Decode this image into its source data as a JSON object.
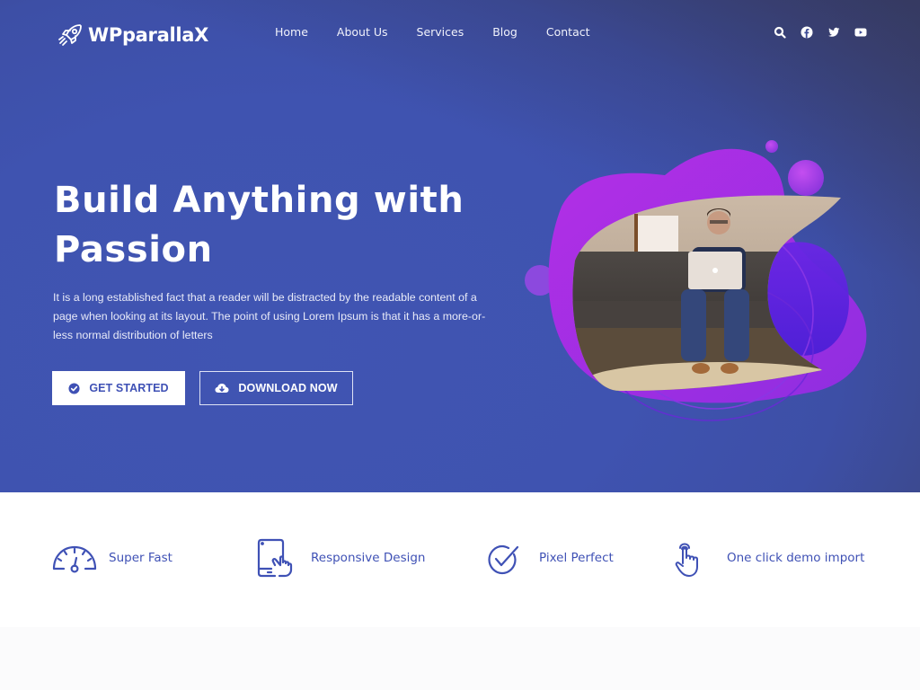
{
  "brand": {
    "name": "WPparallaX",
    "icon": "rocket-icon"
  },
  "nav": {
    "items": [
      {
        "label": "Home"
      },
      {
        "label": "About Us"
      },
      {
        "label": "Services"
      },
      {
        "label": "Blog"
      },
      {
        "label": "Contact"
      }
    ]
  },
  "header_icons": [
    "search-icon",
    "facebook-icon",
    "twitter-icon",
    "youtube-icon"
  ],
  "hero": {
    "title_line1": "Build Anything with",
    "title_line2": "Passion",
    "text": "It is a long established fact that a reader will be distracted by the readable content of a page when looking at its layout. The point of using Lorem Ipsum is that it has a more-or-less normal distribution of letters",
    "primary_button": {
      "label": "GET STARTED",
      "icon": "check-circle-icon"
    },
    "secondary_button": {
      "label": "DOWNLOAD NOW",
      "icon": "cloud-download-icon"
    },
    "image_alt": "Man working on laptop on sofa"
  },
  "features": [
    {
      "label": "Super Fast",
      "icon": "speedometer-icon"
    },
    {
      "label": "Responsive Design",
      "icon": "tablet-touch-icon"
    },
    {
      "label": "Pixel Perfect",
      "icon": "check-circle-outline-icon"
    },
    {
      "label": "One click demo import",
      "icon": "hand-pointer-icon"
    }
  ],
  "colors": {
    "primary": "#3f51b5",
    "hero_bg": "#3f54b1",
    "blob_purple": "#a42ee0",
    "blob_violet": "#5a23dc",
    "white": "#ffffff"
  }
}
